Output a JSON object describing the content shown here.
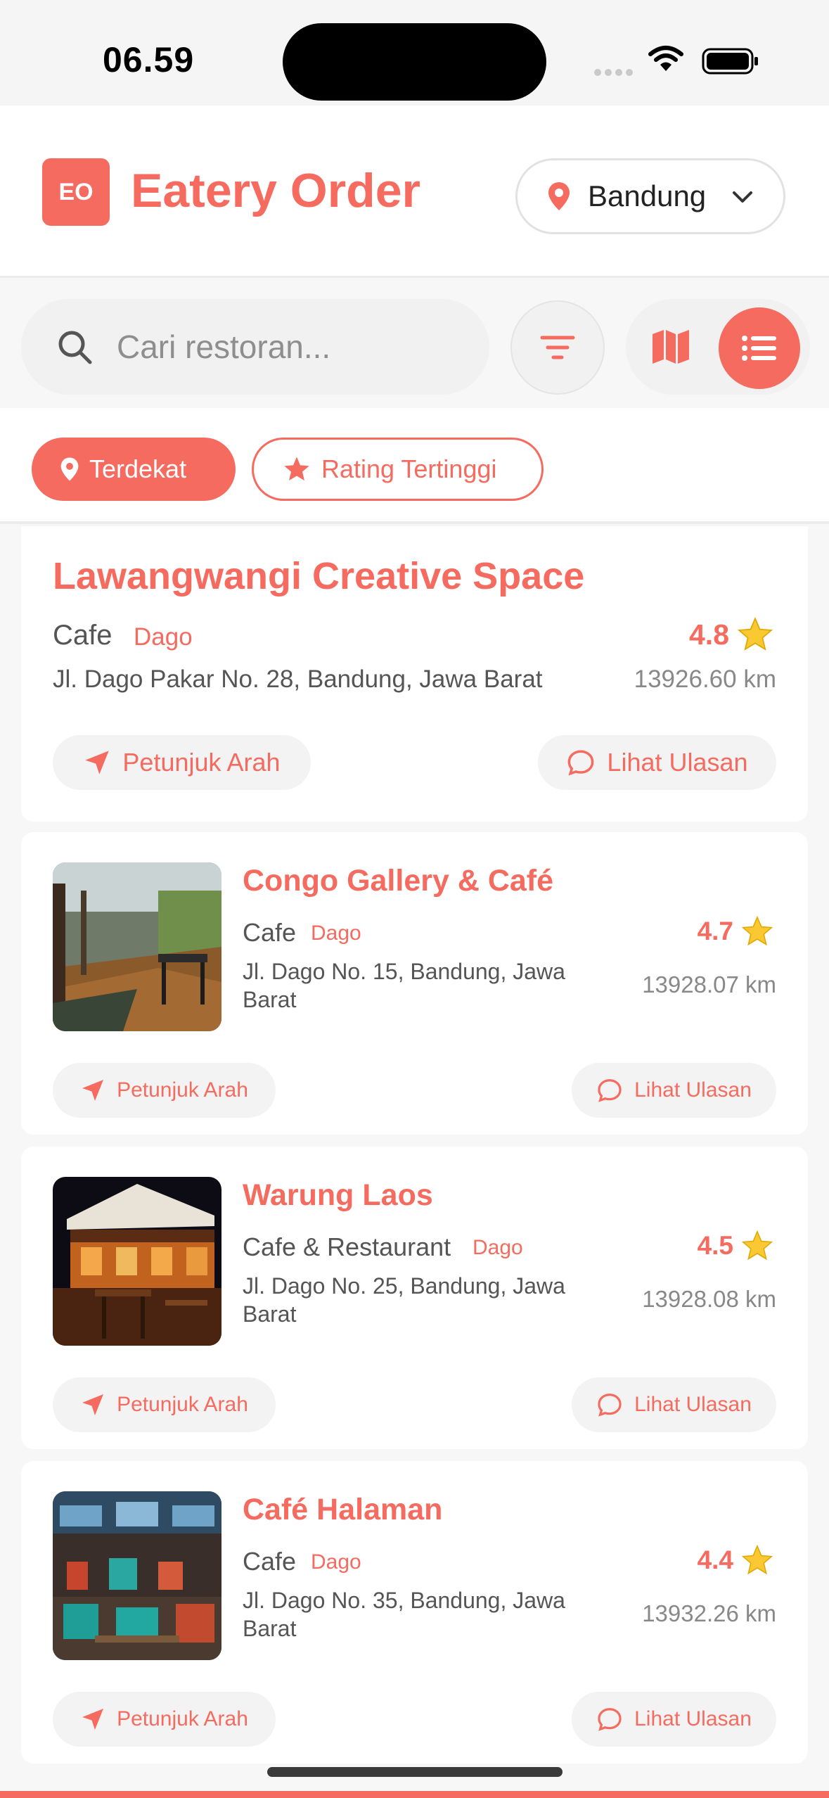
{
  "status_bar": {
    "time": "06.59"
  },
  "header": {
    "logo_text": "EO",
    "title": "Eatery Order",
    "city": "Bandung"
  },
  "search": {
    "placeholder": "Cari restoran...",
    "value": ""
  },
  "chips": {
    "nearest": "Terdekat",
    "top_rating": "Rating Tertinggi",
    "active": "nearest"
  },
  "actions": {
    "directions": "Petunjuk Arah",
    "reviews": "Lihat Ulasan"
  },
  "restaurants": [
    {
      "name": "Lawangwangi Creative Space",
      "type": "Cafe",
      "area": "Dago",
      "address": "Jl. Dago Pakar No. 28, Bandung, Jawa Barat",
      "rating": "4.8",
      "distance": "13926.60 km"
    },
    {
      "name": "Congo Gallery & Café",
      "type": "Cafe",
      "area": "Dago",
      "address": "Jl. Dago No. 15, Bandung, Jawa Barat",
      "rating": "4.7",
      "distance": "13928.07 km"
    },
    {
      "name": "Warung Laos",
      "type": "Cafe & Restaurant",
      "area": "Dago",
      "address": "Jl. Dago No. 25, Bandung, Jawa Barat",
      "rating": "4.5",
      "distance": "13928.08 km"
    },
    {
      "name": "Café Halaman",
      "type": "Cafe",
      "area": "Dago",
      "address": "Jl. Dago No. 35, Bandung, Jawa Barat",
      "rating": "4.4",
      "distance": "13932.26 km"
    }
  ],
  "colors": {
    "accent": "#f56b5f",
    "star": "#f9c833",
    "background": "#f7f7f7"
  },
  "icons": [
    "location-pin-icon",
    "chevron-down-icon",
    "search-icon",
    "filter-icon",
    "map-icon",
    "list-icon",
    "star-icon",
    "navigation-arrow-icon",
    "chat-bubble-icon"
  ]
}
